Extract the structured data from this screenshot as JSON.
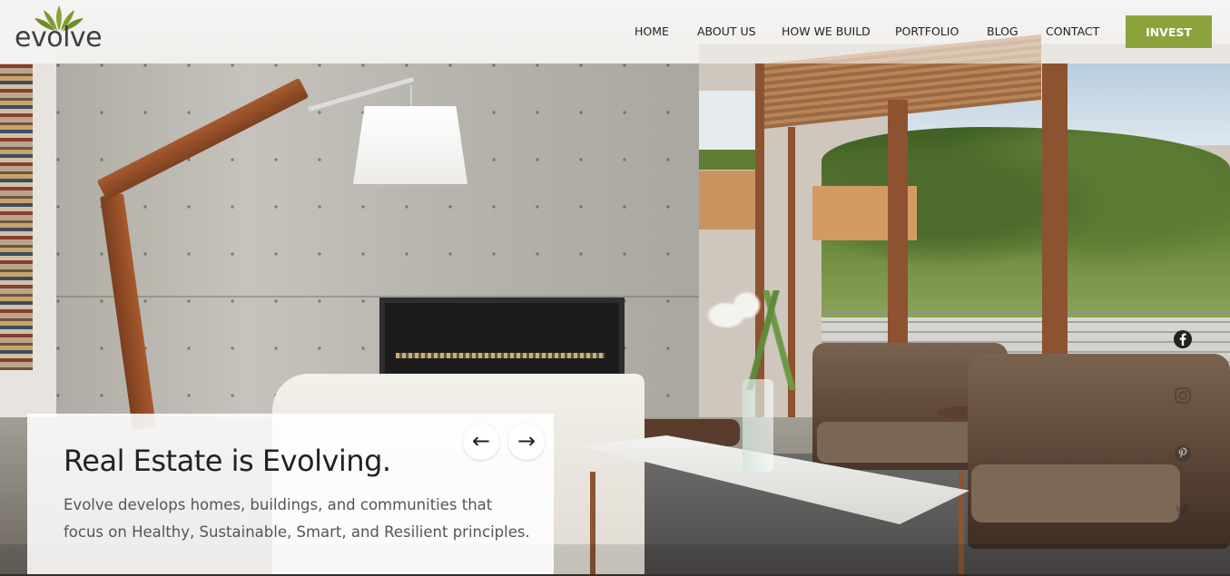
{
  "brand": {
    "name": "evolve"
  },
  "nav": {
    "items": [
      {
        "label": "HOME"
      },
      {
        "label": "ABOUT US"
      },
      {
        "label": "HOW WE BUILD"
      },
      {
        "label": "PORTFOLIO"
      },
      {
        "label": "BLOG"
      },
      {
        "label": "CONTACT"
      }
    ],
    "cta_label": "INVEST"
  },
  "hero": {
    "headline": "Real Estate is Evolving.",
    "subtext": "Evolve develops homes, buildings, and communities that focus on Healthy, Sustainable, Smart, and Resilient principles.",
    "prev_arrow": "←",
    "next_arrow": "→"
  },
  "social": {
    "icons": [
      "facebook-icon",
      "instagram-icon",
      "pinterest-icon",
      "twitter-icon"
    ]
  },
  "colors": {
    "accent": "#8ba33a",
    "logo_leaf": "#8ba33a",
    "text_dark": "#222222",
    "text_body": "#555555"
  }
}
